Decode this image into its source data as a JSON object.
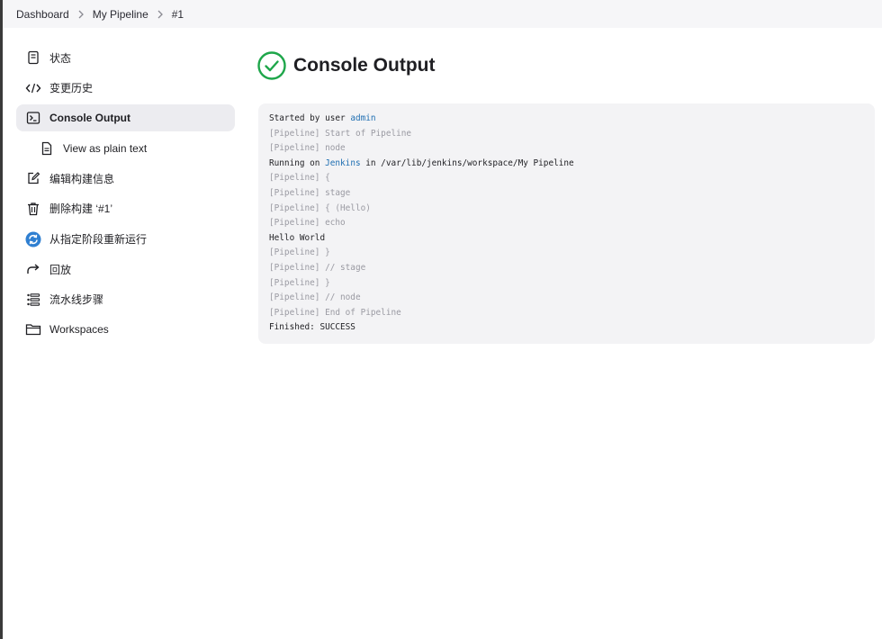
{
  "breadcrumb": {
    "items": [
      {
        "label": "Dashboard"
      },
      {
        "label": "My Pipeline"
      },
      {
        "label": "#1"
      }
    ]
  },
  "sidebar": {
    "items": [
      {
        "label": "状态",
        "icon": "document-icon"
      },
      {
        "label": "变更历史",
        "icon": "code-icon"
      },
      {
        "label": "Console Output",
        "icon": "terminal-icon",
        "active": true
      },
      {
        "label": "View as plain text",
        "icon": "file-text-icon"
      },
      {
        "label": "编辑构建信息",
        "icon": "edit-icon"
      },
      {
        "label": "删除构建 ‘#1’",
        "icon": "trash-icon"
      },
      {
        "label": "从指定阶段重新运行",
        "icon": "restart-icon"
      },
      {
        "label": "回放",
        "icon": "replay-icon"
      },
      {
        "label": "流水线步骤",
        "icon": "list-icon"
      },
      {
        "label": "Workspaces",
        "icon": "folder-icon"
      }
    ]
  },
  "main": {
    "title": "Console Output",
    "status_icon": "success-check-icon",
    "status_color": "#1ea64a"
  },
  "console": {
    "lines": [
      {
        "parts": [
          {
            "text": "Started by user "
          },
          {
            "text": "admin",
            "link": true
          }
        ],
        "dim": false
      },
      {
        "parts": [
          {
            "text": "[Pipeline] Start of Pipeline"
          }
        ],
        "dim": true
      },
      {
        "parts": [
          {
            "text": "[Pipeline] node"
          }
        ],
        "dim": true
      },
      {
        "parts": [
          {
            "text": "Running on "
          },
          {
            "text": "Jenkins",
            "link": true
          },
          {
            "text": " in /var/lib/jenkins/workspace/My Pipeline"
          }
        ],
        "dim": false
      },
      {
        "parts": [
          {
            "text": "[Pipeline] {"
          }
        ],
        "dim": true
      },
      {
        "parts": [
          {
            "text": "[Pipeline] stage"
          }
        ],
        "dim": true
      },
      {
        "parts": [
          {
            "text": "[Pipeline] { (Hello)"
          }
        ],
        "dim": true
      },
      {
        "parts": [
          {
            "text": "[Pipeline] echo"
          }
        ],
        "dim": true
      },
      {
        "parts": [
          {
            "text": "Hello World"
          }
        ],
        "dim": false
      },
      {
        "parts": [
          {
            "text": "[Pipeline] }"
          }
        ],
        "dim": true
      },
      {
        "parts": [
          {
            "text": "[Pipeline] // stage"
          }
        ],
        "dim": true
      },
      {
        "parts": [
          {
            "text": "[Pipeline] }"
          }
        ],
        "dim": true
      },
      {
        "parts": [
          {
            "text": "[Pipeline] // node"
          }
        ],
        "dim": true
      },
      {
        "parts": [
          {
            "text": "[Pipeline] End of Pipeline"
          }
        ],
        "dim": true
      },
      {
        "parts": [
          {
            "text": "Finished: SUCCESS"
          }
        ],
        "dim": false
      }
    ],
    "link_color": "#1f6fb2",
    "dim_color": "#9a9aa2"
  }
}
